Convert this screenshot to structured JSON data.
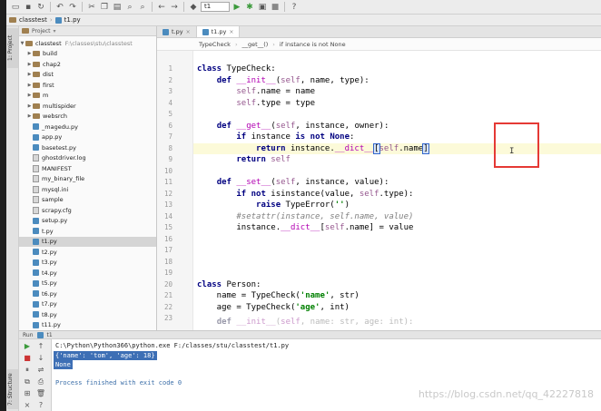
{
  "toolbar": {
    "run_config": "t1",
    "icons": [
      "folder-open-icon",
      "save-icon",
      "sync-icon",
      "undo-icon",
      "redo-icon",
      "cut-icon",
      "copy-icon",
      "paste-icon",
      "find-icon",
      "replace-icon",
      "back-icon",
      "forward-icon",
      "run-config-dropdown",
      "run-icon",
      "debug-icon",
      "coverage-icon",
      "stop-icon",
      "help-icon"
    ]
  },
  "navbar": {
    "project": "classtest",
    "file": "t1.py"
  },
  "project_panel": {
    "header": "Project",
    "side_tab_project": "1: Project",
    "side_tab_structure": "7: Structure",
    "root": {
      "name": "classtest",
      "path": "F:\\classes\\stu\\classtest"
    },
    "items": [
      {
        "name": "build",
        "type": "folder"
      },
      {
        "name": "chap2",
        "type": "folder"
      },
      {
        "name": "dist",
        "type": "folder"
      },
      {
        "name": "first",
        "type": "folder"
      },
      {
        "name": "m",
        "type": "folder"
      },
      {
        "name": "multispider",
        "type": "folder"
      },
      {
        "name": "websrch",
        "type": "folder"
      },
      {
        "name": "_magedu.py",
        "type": "py"
      },
      {
        "name": "app.py",
        "type": "py"
      },
      {
        "name": "basetest.py",
        "type": "py"
      },
      {
        "name": "ghostdriver.log",
        "type": "file"
      },
      {
        "name": "MANIFEST",
        "type": "file"
      },
      {
        "name": "my_binary_file",
        "type": "file"
      },
      {
        "name": "mysql.ini",
        "type": "file"
      },
      {
        "name": "sample",
        "type": "file"
      },
      {
        "name": "scrapy.cfg",
        "type": "file"
      },
      {
        "name": "setup.py",
        "type": "py"
      },
      {
        "name": "t.py",
        "type": "py"
      },
      {
        "name": "t1.py",
        "type": "py",
        "selected": true
      },
      {
        "name": "t2.py",
        "type": "py"
      },
      {
        "name": "t3.py",
        "type": "py"
      },
      {
        "name": "t4.py",
        "type": "py"
      },
      {
        "name": "t5.py",
        "type": "py"
      },
      {
        "name": "t6.py",
        "type": "py"
      },
      {
        "name": "t7.py",
        "type": "py"
      },
      {
        "name": "t8.py",
        "type": "py"
      },
      {
        "name": "t11.py",
        "type": "py"
      }
    ]
  },
  "editor": {
    "tabs": [
      {
        "label": "t.py",
        "active": false
      },
      {
        "label": "t1.py",
        "active": true
      }
    ],
    "breadcrumb": [
      "TypeCheck",
      "__get__()",
      "if instance is not None"
    ],
    "line_numbers": [
      "1",
      "2",
      "3",
      "4",
      "5",
      "6",
      "7",
      "8",
      "9",
      "10",
      "11",
      "12",
      "13",
      "14",
      "15",
      "16",
      "17",
      "18",
      "19",
      "20",
      "21",
      "22",
      "23"
    ],
    "current_line": 9
  },
  "run_panel": {
    "header_label": "Run",
    "config": "t1",
    "command": "C:\\Python\\Python366\\python.exe F:/classes/stu/classtest/t1.py",
    "output_line1": "{'name': 'tom', 'age': 18}",
    "output_line2": "None",
    "exit_line": "Process finished with exit code 0"
  },
  "watermark": "https://blog.csdn.net/qq_42227818",
  "colors": {
    "annotation_red": "#e53935",
    "selection_blue": "#3d6fb5",
    "keyword": "#000080",
    "self": "#94558d",
    "string": "#008000"
  }
}
